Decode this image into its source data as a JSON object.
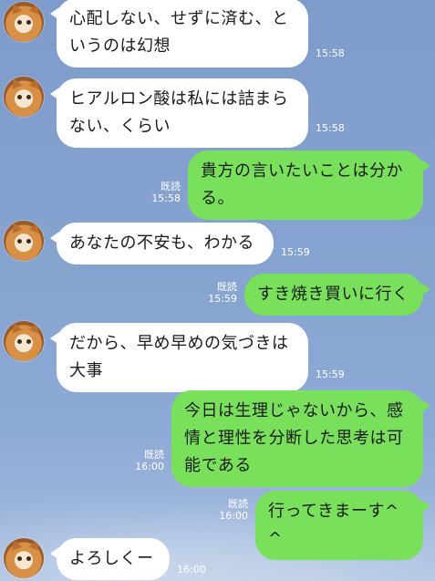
{
  "messages": [
    {
      "side": "in",
      "text": "心配しない、せずに済む、というのは幻想",
      "time": "15:58"
    },
    {
      "side": "in",
      "text": "ヒアルロン酸は私には詰まらない、くらい",
      "time": "15:58"
    },
    {
      "side": "out",
      "text": "貴方の言いたいことは分かる。",
      "read": "既読",
      "time": "15:58"
    },
    {
      "side": "in",
      "text": "あなたの不安も、わかる",
      "time": "15:59"
    },
    {
      "side": "out",
      "text": "すき焼き買いに行く",
      "read": "既読",
      "time": "15:59"
    },
    {
      "side": "in",
      "text": "だから、早め早めの気づきは大事",
      "time": "15:59"
    },
    {
      "side": "out",
      "text": "今日は生理じゃないから、感情と理性を分断した思考は可能である",
      "read": "既読",
      "time": "16:00"
    },
    {
      "side": "out",
      "text": "行ってきまーす^ ^",
      "read": "既読",
      "time": "16:00"
    },
    {
      "side": "in",
      "text": "よろしくー",
      "time": "16:00"
    }
  ],
  "colors": {
    "outgoing": "#78e05b",
    "incoming": "#ffffff",
    "background": "#86a3d0"
  },
  "avatar_icon": "cat-avatar-icon"
}
